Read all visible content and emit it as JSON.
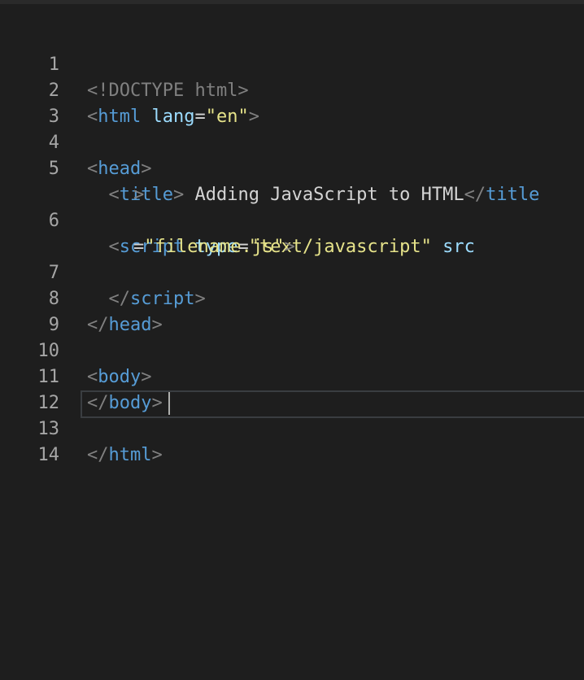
{
  "editor": {
    "line_numbers": [
      "1",
      "2",
      "3",
      "4",
      "5",
      "6",
      "7",
      "8",
      "9",
      "10",
      "11",
      "12",
      "13",
      "14"
    ],
    "lines": {
      "l1": {
        "doctype": "<!DOCTYPE html>"
      },
      "l2": {
        "open": "<",
        "tag": "html",
        "attr": "lang",
        "eq": "=",
        "val": "\"en\"",
        "close": ">"
      },
      "l4": {
        "open": "<",
        "tag": "head",
        "close": ">"
      },
      "l5": {
        "indent": "  ",
        "open": "<",
        "tag": "title",
        "close": ">",
        "text": " Adding JavaScript to HTML",
        "end_open": "</",
        "end_tag": "title",
        "wrap_close": ">"
      },
      "l6": {
        "indent": "  ",
        "open": "<",
        "tag": "script",
        "attr1": "type",
        "eq1": "=",
        "val1": "\"text/javascript\"",
        "attr2": "src",
        "wrap_eq": "=",
        "val2": "\"filename.js\"",
        "close": ">"
      },
      "l7": {
        "indent": "  ",
        "open": "</",
        "tag": "script",
        "close": ">"
      },
      "l8": {
        "open": "</",
        "tag": "head",
        "close": ">"
      },
      "l10": {
        "open": "<",
        "tag": "body",
        "close": ">"
      },
      "l11": {
        "open": "</",
        "tag": "body",
        "close": ">"
      },
      "l13": {
        "open": "</",
        "tag": "html",
        "close": ">"
      }
    },
    "colors": {
      "background": "#1e1e1e",
      "tag": "#569cd6",
      "attribute": "#9cdcfe",
      "string": "#e6e38a",
      "bracket": "#808080"
    }
  }
}
